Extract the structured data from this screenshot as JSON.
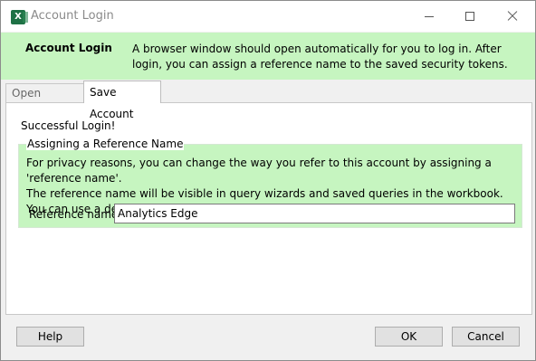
{
  "window": {
    "title": "Account Login",
    "icon": "excel-app-icon",
    "icon_letter": "X"
  },
  "header": {
    "title": "Account Login",
    "description": "A browser window should open automatically for you to log in. After login, you can assign a reference name to the saved security tokens."
  },
  "tabs": [
    {
      "label": "Open Browser",
      "active": false
    },
    {
      "label": "Save Account",
      "active": true
    }
  ],
  "panel": {
    "status": "Successful Login!",
    "group": {
      "legend": "Assigning a Reference Name",
      "lines": [
        "For privacy reasons, you can change the way you refer to this account by assigning a 'reference name'.",
        "The reference name will be visible in query wizards and saved queries in the workbook.",
        "You can use a descriptive name such as 'Acme Company'."
      ],
      "field_label": "Reference name:",
      "field_value": "Analytics Edge"
    }
  },
  "buttons": {
    "help": "Help",
    "ok": "OK",
    "cancel": "Cancel"
  },
  "colors": {
    "accent_green": "#c6f5c0",
    "window_bg": "#f0f0f0"
  }
}
